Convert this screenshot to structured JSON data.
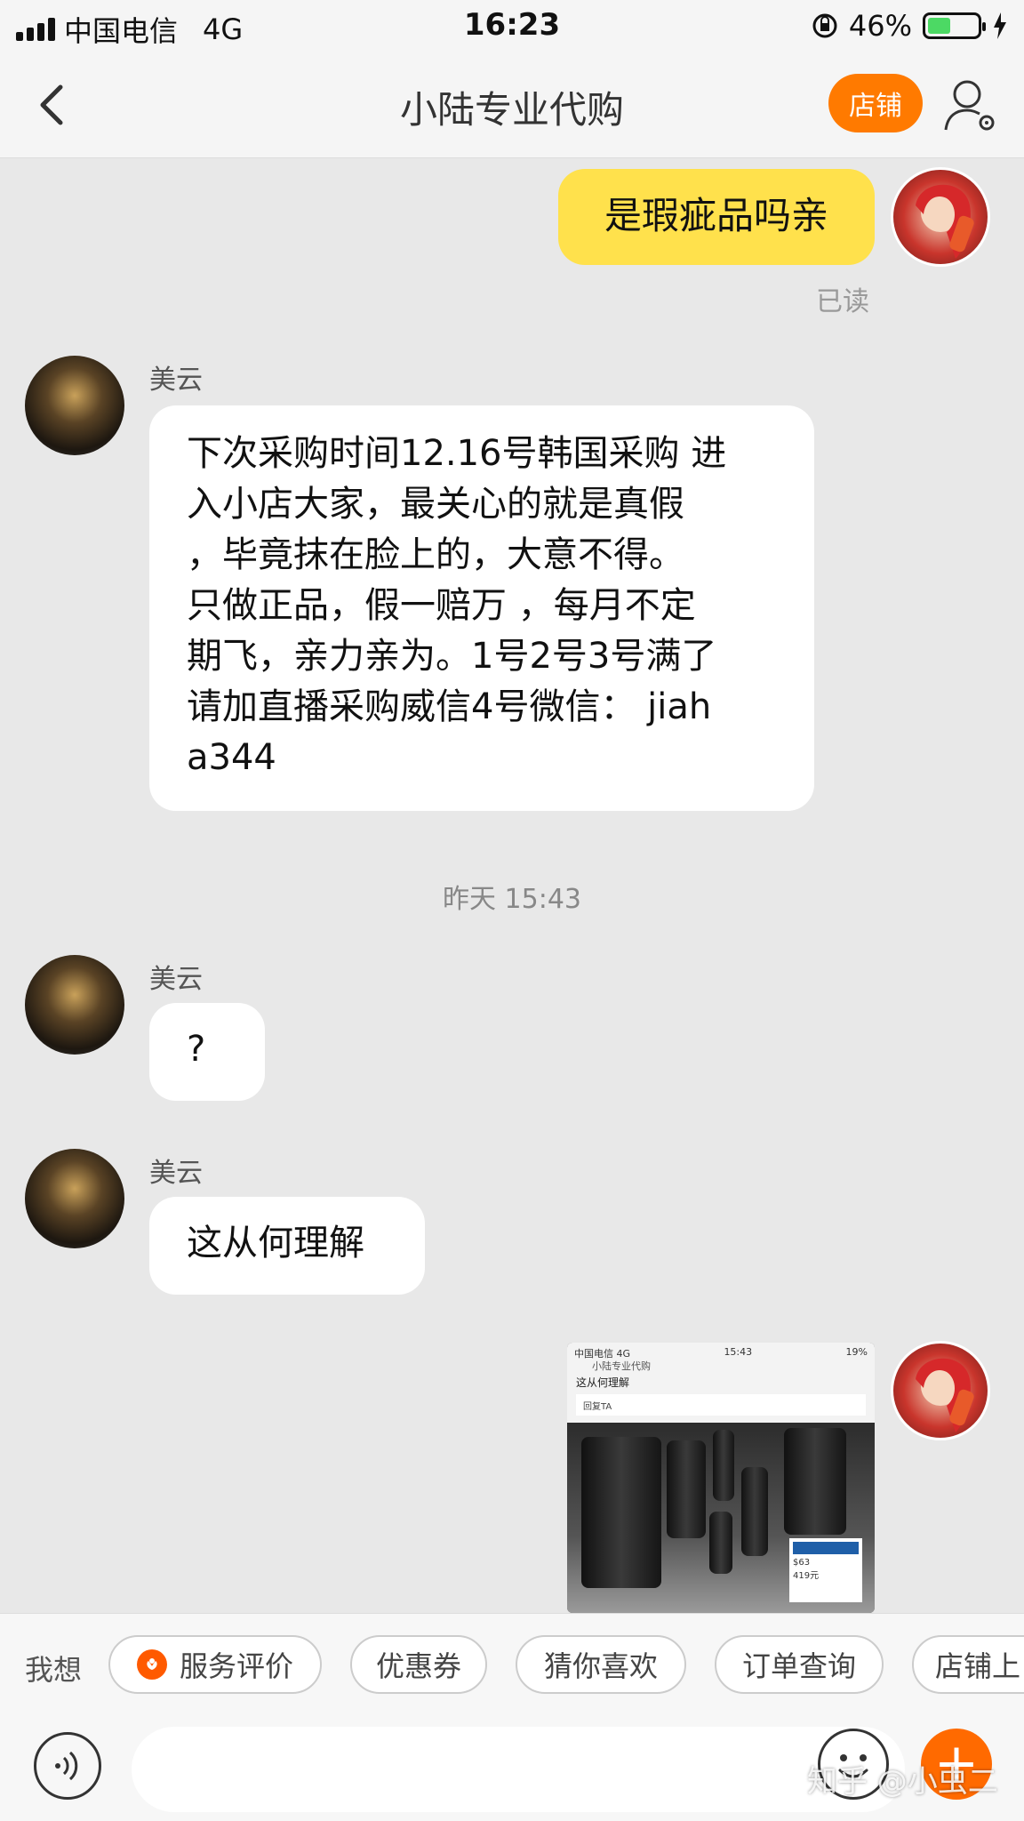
{
  "status_bar": {
    "carrier": "中国电信",
    "network": "4G",
    "time": "16:23",
    "battery_percent": "46%",
    "battery_level": 0.46
  },
  "nav": {
    "title": "小陆专业代购",
    "shop_label": "店铺"
  },
  "messages": [
    {
      "type": "text",
      "from": "self",
      "text": "是瑕疵品吗亲",
      "status": "已读"
    },
    {
      "type": "text",
      "from": "other",
      "sender": "美云",
      "text": "下次采购时间12.16号韩国采购 进\n入小店大家，最关心的就是真假\n，毕竟抹在脸上的，大意不得。\n只做正品，假一赔万 ，每月不定\n期飞，亲力亲为。1号2号3号满了\n请加直播采购威信4号微信： jiah\na344"
    },
    {
      "type": "timestamp",
      "text": "昨天 15:43"
    },
    {
      "type": "text",
      "from": "other",
      "sender": "美云",
      "text": "?"
    },
    {
      "type": "text",
      "from": "other",
      "sender": "美云",
      "text": "这从何理解"
    },
    {
      "type": "image",
      "from": "self",
      "thumbnail": {
        "status_left": "中国电信  4G",
        "status_time": "15:43",
        "status_right": "19%",
        "title": "小陆专业代购",
        "message": "这从何理解",
        "reply": "回复TA",
        "price_line1": "$63",
        "price_line2": "419元"
      }
    }
  ],
  "quick_bar": {
    "label": "我想",
    "chips": [
      "服务评价",
      "优惠券",
      "猜你喜欢",
      "订单查询",
      "店铺上"
    ]
  },
  "input_bar": {
    "placeholder": "",
    "watermark": "知乎 @小虫二"
  },
  "colors": {
    "accent": "#ff7a00",
    "self_bubble": "#ffe14c",
    "background": "#e8e8e8"
  }
}
